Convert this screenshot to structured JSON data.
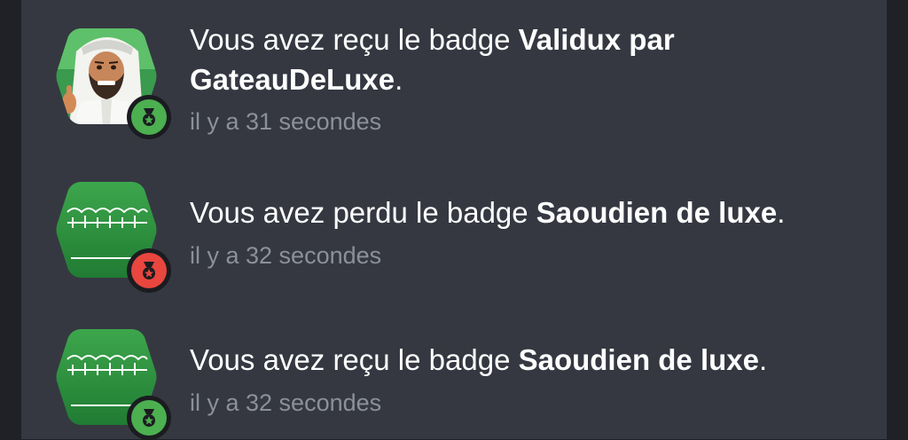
{
  "notifications": [
    {
      "prefix": "Vous avez reçu le badge ",
      "badge_name": "Validux par GateauDeLuxe",
      "suffix": ".",
      "time": "il y a 31 secondes",
      "status": "received",
      "badge_icon": "avatar-man-thumbs-up",
      "status_color": "#4caf50"
    },
    {
      "prefix": "Vous avez perdu le badge ",
      "badge_name": "Saoudien de luxe",
      "suffix": ".",
      "time": "il y a 32 secondes",
      "status": "lost",
      "badge_icon": "saudi-flag",
      "status_color": "#e8463e"
    },
    {
      "prefix": "Vous avez reçu le badge ",
      "badge_name": "Saoudien de luxe",
      "suffix": ".",
      "time": "il y a 32 secondes",
      "status": "received",
      "badge_icon": "saudi-flag",
      "status_color": "#4caf50"
    }
  ]
}
